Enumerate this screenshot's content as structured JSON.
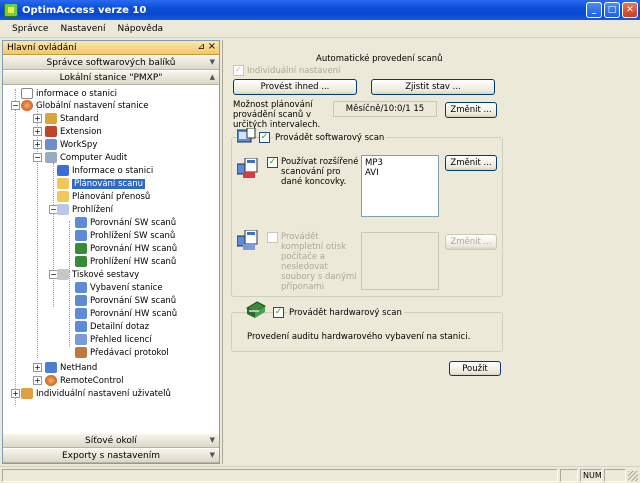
{
  "window": {
    "title": "OptimAccess verze 10"
  },
  "menu": {
    "items": [
      "Správce",
      "Nastavení",
      "Nápověda"
    ]
  },
  "left_panel": {
    "header": "Hlavní ovládání",
    "top_buttons": [
      "Správce softwarových balíků",
      "Lokální stanice \"PMXP\""
    ],
    "bottom_buttons": [
      "Síťové okolí",
      "Exporty s nastavením"
    ],
    "tree": [
      "informace o stanici",
      "Globální nastavení stanice",
      "Standard",
      "Extension",
      "WorkSpy",
      "Computer Audit",
      "Informace o stanici",
      "Plánování scanu",
      "Plánování přenosů",
      "Prohlížení",
      "Porovnání SW scanů",
      "Prohlížení SW scanů",
      "Porovnání HW scanů",
      "Prohlížení HW scanů",
      "Tiskové sestavy",
      "Vybavení stanice",
      "Porovnání SW scanů",
      "Porovnání HW scanů",
      "Detailní dotaz",
      "Přehled licencí",
      "Předávací protokol",
      "NetHand",
      "RemoteControl",
      "Individuální nastavení uživatelů"
    ]
  },
  "main": {
    "title": "Automatické provedení scanů",
    "individual_label": "Individuální nastavení",
    "run_now_button": "Provést ihned ...",
    "check_state_button": "Zjistit stav ...",
    "schedule_label": "Možnost plánování provádění scanů v určitých intervalech.",
    "schedule_value": "Měsíčně/10:0/1 15",
    "change_button": "Změnit ...",
    "sw_scan_label": "Provádět softwarový scan",
    "extended_label": "Používat rozšířené scanování pro dané koncovky.",
    "extensions": [
      "MP3",
      "AVI"
    ],
    "change_ext_button": "Změnit ...",
    "full_print_label": "Provádět kompletní otisk počítače a nesledovat soubory s danými příponami",
    "change_full_button": "Změnit ...",
    "hw_scan_label": "Provádět hardwarový scan",
    "hw_desc": "Provedení auditu hardwarového vybavení na stanici.",
    "apply_button": "Použít"
  },
  "status": {
    "num": "NUM"
  }
}
